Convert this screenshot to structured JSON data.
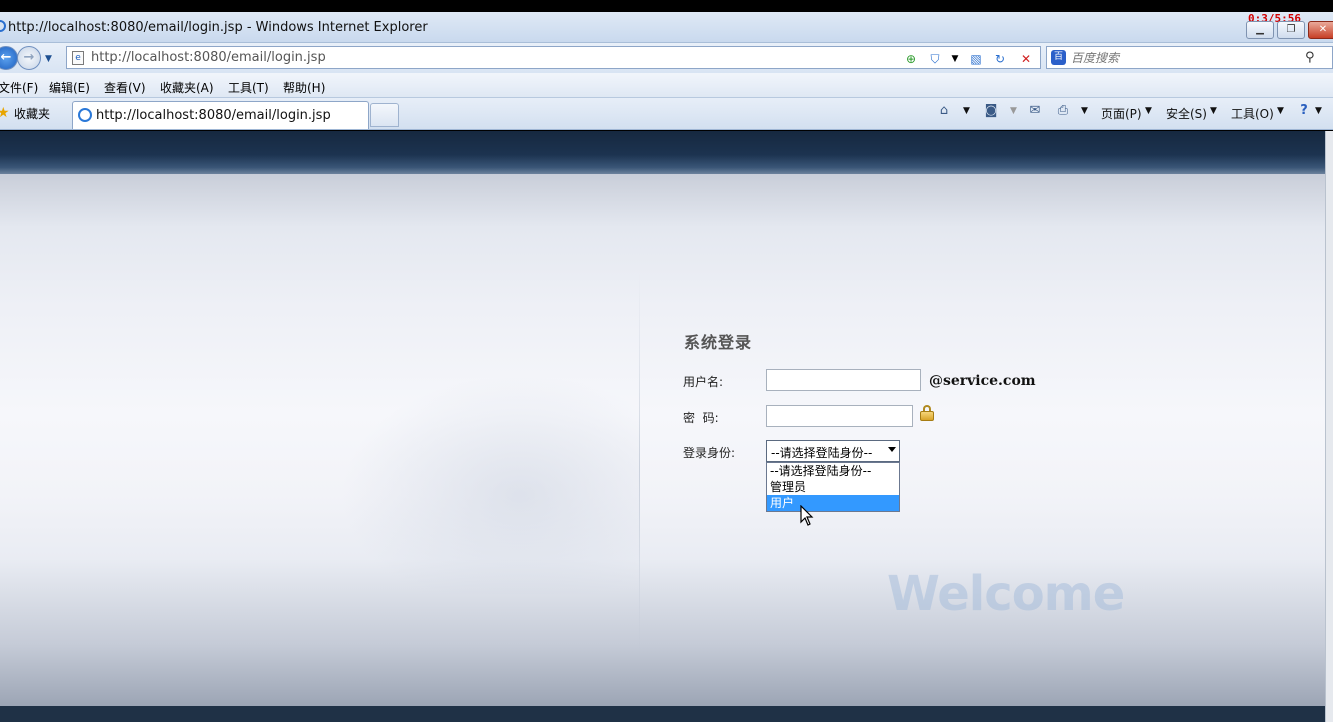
{
  "window": {
    "title": "http://localhost:8080/email/login.jsp - Windows Internet Explorer",
    "timer": "0:3/5:56"
  },
  "address_bar": {
    "url": "http://localhost:8080/email/login.jsp",
    "search_placeholder": "百度搜索"
  },
  "menu": {
    "items": [
      "文件(F)",
      "编辑(E)",
      "查看(V)",
      "收藏夹(A)",
      "工具(T)",
      "帮助(H)"
    ]
  },
  "favorites": {
    "label": "收藏夹"
  },
  "tab": {
    "title": "http://localhost:8080/email/login.jsp"
  },
  "command_bar": {
    "page": "页面(P)",
    "safety": "安全(S)",
    "tools": "工具(O)"
  },
  "login": {
    "title": "系统登录",
    "username_label": "用户名:",
    "username_value": "",
    "domain_suffix": "@service.com",
    "password_label": "密  码:",
    "password_value": "",
    "role_label": "登录身份:",
    "role_selected": "--请选择登陆身份--",
    "role_options": [
      "--请选择登陆身份--",
      "管理员",
      "用户"
    ],
    "role_highlighted_index": 2
  },
  "decor": {
    "welcome": "Welcome"
  },
  "colors": {
    "header_dark": "#1c3350",
    "highlight": "#3399ff",
    "close_button": "#c73f26"
  }
}
